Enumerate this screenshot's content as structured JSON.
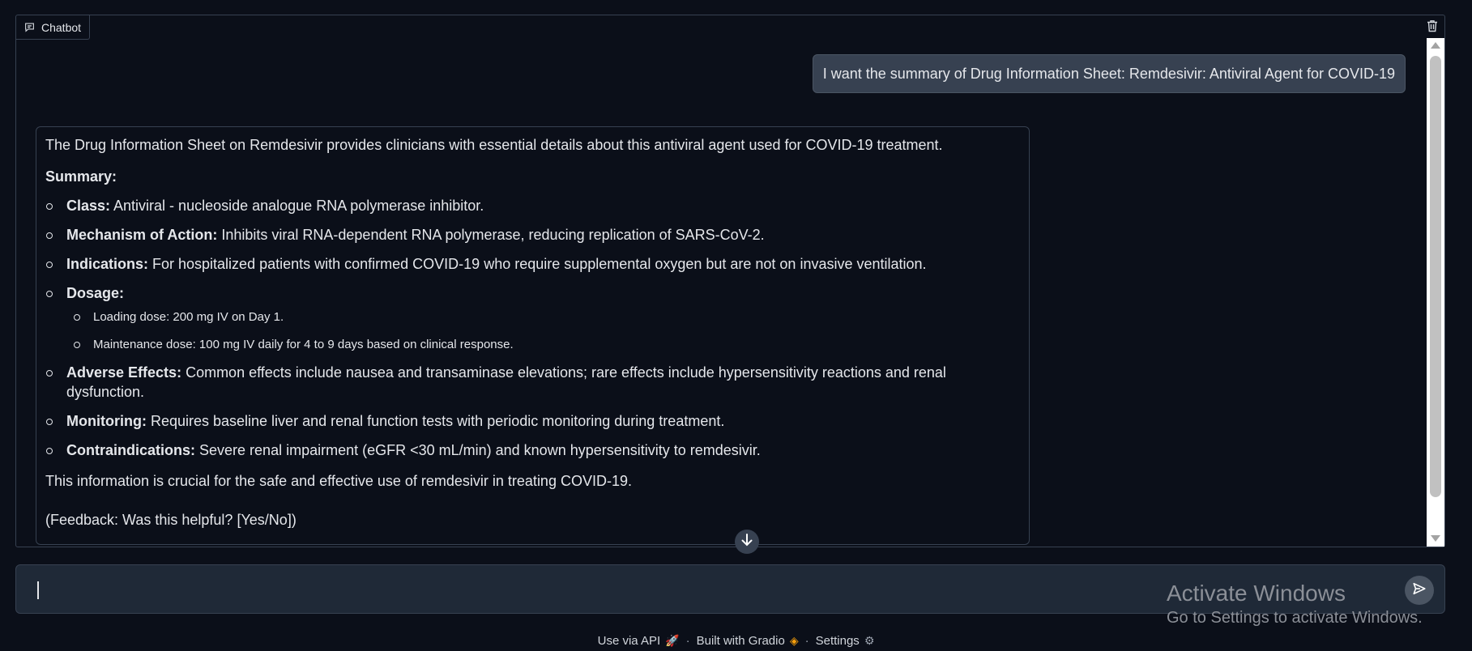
{
  "chatbot": {
    "label": "Chatbot",
    "icons": {
      "label_icon": "chat-icon",
      "clear": "trash-icon",
      "scroll_down": "arrow-down-icon"
    }
  },
  "messages": {
    "user": "I want the summary of Drug Information Sheet: Remdesivir: Antiviral Agent for COVID-19",
    "bot": {
      "intro": "The Drug Information Sheet on Remdesivir provides clinicians with essential details about this antiviral agent used for COVID-19 treatment.",
      "summary_heading": "Summary:",
      "items": [
        {
          "label": "Class:",
          "text": " Antiviral - nucleoside analogue RNA polymerase inhibitor."
        },
        {
          "label": "Mechanism of Action:",
          "text": " Inhibits viral RNA-dependent RNA polymerase, reducing replication of SARS-CoV-2."
        },
        {
          "label": "Indications:",
          "text": " For hospitalized patients with confirmed COVID-19 who require supplemental oxygen but are not on invasive ventilation."
        },
        {
          "label": "Dosage:",
          "text": ""
        },
        {
          "label": "Adverse Effects:",
          "text": " Common effects include nausea and transaminase elevations; rare effects include hypersensitivity reactions and renal dysfunction."
        },
        {
          "label": "Monitoring:",
          "text": " Requires baseline liver and renal function tests with periodic monitoring during treatment."
        },
        {
          "label": "Contraindications:",
          "text": " Severe renal impairment (eGFR <30 mL/min) and known hypersensitivity to remdesivir."
        }
      ],
      "dosage_subitems": [
        "Loading dose: 200 mg IV on Day 1.",
        "Maintenance dose: 100 mg IV daily for 4 to 9 days based on clinical response."
      ],
      "closing": "This information is crucial for the safe and effective use of remdesivir in treating COVID-19.",
      "feedback": "(Feedback: Was this helpful? [Yes/No])"
    }
  },
  "input": {
    "value": "",
    "placeholder": "",
    "send_icon": "send-icon"
  },
  "watermark": {
    "title": "Activate Windows",
    "subtitle": "Go to Settings to activate Windows."
  },
  "footer": {
    "api_label": "Use via API",
    "built_label": "Built with Gradio",
    "settings_label": "Settings",
    "separator": "·"
  },
  "colors": {
    "background": "#0b0f19",
    "panel_border": "#374151",
    "user_bubble": "#374151",
    "input_bg": "#1f2937",
    "text": "#e5e7eb"
  }
}
